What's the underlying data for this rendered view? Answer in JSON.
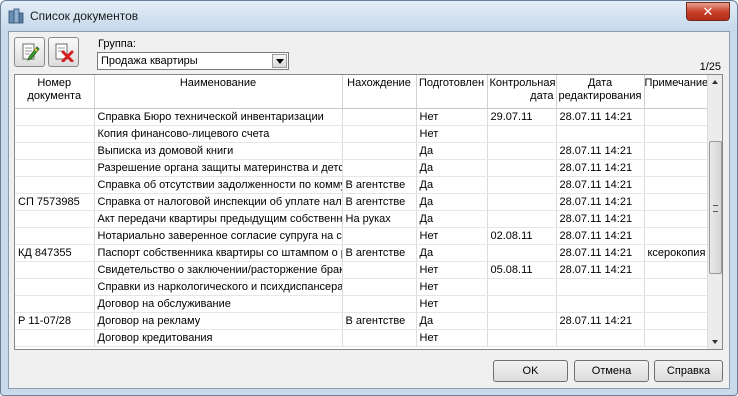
{
  "window": {
    "title": "Список документов"
  },
  "toolbar": {
    "add_icon": "edit-add-icon",
    "delete_icon": "delete-icon"
  },
  "group": {
    "label": "Группа:",
    "selected": "Продажа квартиры"
  },
  "pager": {
    "text": "1/25"
  },
  "table": {
    "columns": [
      "Номер документа",
      "Наименование",
      "Нахождение",
      "Подготовлен",
      "Контрольная дата",
      "Дата редактирования",
      "Примечание"
    ],
    "rows": [
      [
        "",
        "Справка Бюро технической инвентаризации",
        "",
        "Нет",
        "29.07.11",
        "28.07.11 14:21",
        ""
      ],
      [
        "",
        "Копия финансово-лицевого счета",
        "",
        "Нет",
        "",
        "",
        ""
      ],
      [
        "",
        "Выписка из домовой книги",
        "",
        "Да",
        "",
        "28.07.11 14:21",
        ""
      ],
      [
        "",
        "Разрешение органа защиты материнства и детства",
        "",
        "Да",
        "",
        "28.07.11 14:21",
        ""
      ],
      [
        "",
        "Справка об отсутствии задолженности по коммунальным платежам",
        "В агентстве",
        "Да",
        "",
        "28.07.11 14:21",
        ""
      ],
      [
        "СП 7573985",
        "Справка от налоговой инспекции об уплате налогов",
        "В агентстве",
        "Да",
        "",
        "28.07.11 14:21",
        ""
      ],
      [
        "",
        "Акт передачи квартиры предыдущим собственником",
        "На руках",
        "Да",
        "",
        "28.07.11 14:21",
        ""
      ],
      [
        "",
        "Нотариально заверенное согласие супруга на сделку",
        "",
        "Нет",
        "02.08.11",
        "28.07.11 14:21",
        ""
      ],
      [
        "КД 847355",
        "Паспорт собственника квартиры со штампом о регистрации",
        "В агентстве",
        "Да",
        "",
        "28.07.11 14:21",
        "ксерокопия"
      ],
      [
        "",
        "Свидетельство о заключении/расторжение брака",
        "",
        "Нет",
        "05.08.11",
        "28.07.11 14:21",
        ""
      ],
      [
        "",
        "Справки из наркологического и психдиспансера",
        "",
        "Нет",
        "",
        "",
        ""
      ],
      [
        "",
        "Договор на обслуживание",
        "",
        "Нет",
        "",
        "",
        ""
      ],
      [
        "Р 11-07/28",
        "Договор на рекламу",
        "В агентстве",
        "Да",
        "",
        "28.07.11 14:21",
        ""
      ],
      [
        "",
        "Договор кредитования",
        "",
        "Нет",
        "",
        "",
        ""
      ]
    ]
  },
  "buttons": {
    "ok": "OK",
    "cancel": "Отмена",
    "help": "Справка"
  },
  "colors": {
    "title_bg": "#c6d8ea",
    "close_btn": "#c8432d",
    "client_bg": "#f0f0f0"
  }
}
